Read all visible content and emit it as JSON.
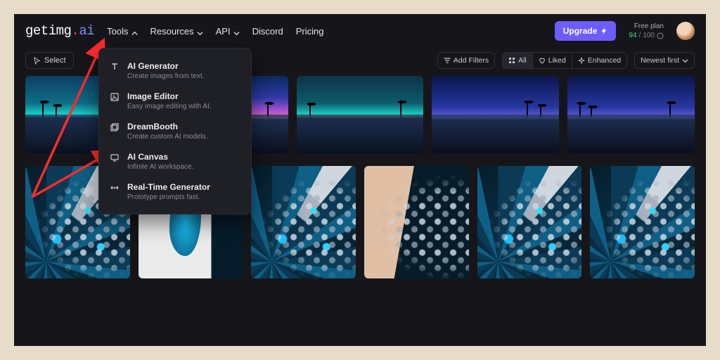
{
  "brand": {
    "left": "getimg",
    "dot": ".",
    "right": "ai"
  },
  "nav": {
    "tools": "Tools",
    "resources": "Resources",
    "api": "API",
    "discord": "Discord",
    "pricing": "Pricing"
  },
  "dropdown": {
    "items": [
      {
        "title": "AI Generator",
        "sub": "Create images from text.",
        "icon": "type-icon"
      },
      {
        "title": "Image Editor",
        "sub": "Easy image editing with AI.",
        "icon": "image-icon"
      },
      {
        "title": "DreamBooth",
        "sub": "Create custom AI models.",
        "icon": "layers-icon"
      },
      {
        "title": "AI Canvas",
        "sub": "Infinite AI workspace.",
        "icon": "canvas-icon"
      },
      {
        "title": "Real-Time Generator",
        "sub": "Prototype prompts fast.",
        "icon": "realtime-icon"
      }
    ]
  },
  "cta": {
    "upgrade": "Upgrade"
  },
  "plan": {
    "label": "Free plan",
    "used": "94",
    "sep": " / ",
    "total": "100"
  },
  "toolbar": {
    "select": "Select",
    "addFilters": "Add Filters",
    "all": "All",
    "liked": "Liked",
    "enhanced": "Enhanced",
    "sort": "Newest first"
  },
  "colors": {
    "accent": "#6d5cff",
    "annotation": "#ff2b2b",
    "bg": "#16161a"
  }
}
